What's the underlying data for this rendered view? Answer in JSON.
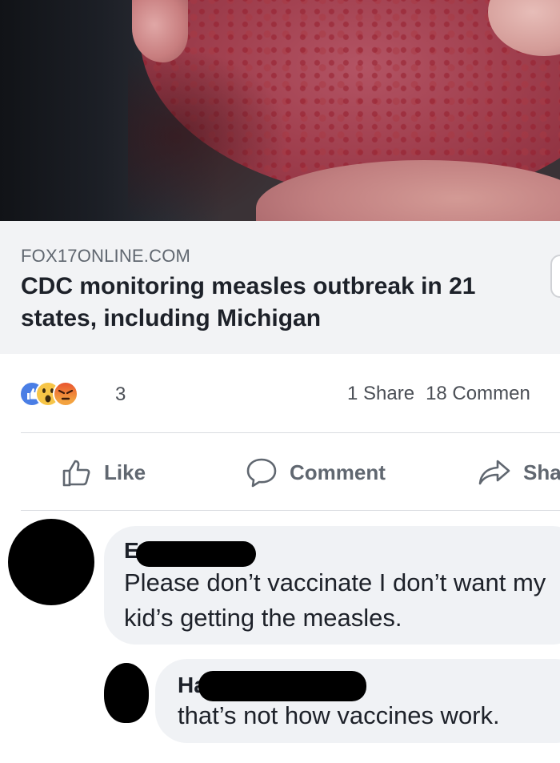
{
  "post": {
    "link": {
      "domain": "FOX17ONLINE.COM",
      "title": "CDC monitoring measles outbreak in 21 states, including Michigan"
    },
    "reactions": {
      "icons": [
        "like-icon",
        "wow-icon",
        "angry-icon"
      ],
      "count": "3"
    },
    "stats": {
      "shares": "1 Share",
      "comments": "18 Commen"
    },
    "actions": {
      "like": "Like",
      "comment": "Comment",
      "share": "Sha"
    }
  },
  "comments": [
    {
      "author_visible": "E",
      "text": "Please don’t vaccinate I don’t want my kid’s getting the measles."
    },
    {
      "author_visible": "Ha",
      "text": "that’s not how vaccines work."
    }
  ],
  "colors": {
    "link_card_bg": "#f2f3f5",
    "bubble_bg": "#f0f2f5",
    "like_blue": "#4a7ee5",
    "wow_yellow": "#f7c547",
    "angry_red": "#e9552f",
    "muted_text": "#606770"
  }
}
